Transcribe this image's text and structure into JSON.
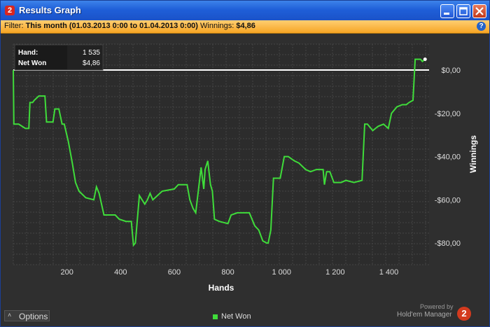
{
  "window": {
    "title": "Results Graph",
    "app_icon_char": "2",
    "buttons": {
      "minimize_icon": "minimize-icon",
      "maximize_icon": "maximize-icon",
      "close_icon": "close-icon"
    }
  },
  "filter_bar": {
    "label": "Filter:",
    "period": "This month (01.03.2013 0:00 to 01.04.2013 0:00)",
    "winnings_label": "Winnings:",
    "winnings_value": "$4,86",
    "help_icon": "help-icon",
    "help_char": "?"
  },
  "tooltip": {
    "hand_label": "Hand:",
    "hand_value": "1 535",
    "net_label": "Net Won",
    "net_value": "$4,86"
  },
  "footer": {
    "options_label": "Options",
    "options_icon": "chevron-up-icon",
    "options_chevron": "˄",
    "legend_label": "Net Won",
    "powered_by": "Powered by",
    "brand": "Hold'em Manager",
    "brand_logo_char": "2"
  },
  "colors": {
    "line": "#3fdc3a",
    "baseline": "#ffffff",
    "plot_bg": "#2c2c2c",
    "title_bar": "#1f5fd8",
    "filter_bar": "#f6a524"
  },
  "chart_data": {
    "type": "line",
    "xlabel": "Hands",
    "ylabel": "Winnings",
    "xlim": [
      0,
      1550
    ],
    "ylim": [
      -90,
      12
    ],
    "x_ticks": [
      200,
      400,
      600,
      800,
      1000,
      1200,
      1400
    ],
    "x_tick_labels": [
      "200",
      "400",
      "600",
      "800",
      "1 000",
      "1 200",
      "1 400"
    ],
    "y_ticks": [
      0,
      -20,
      -40,
      -60,
      -80
    ],
    "y_tick_labels": [
      "$0,00",
      "-$20,00",
      "-$40,00",
      "-$60,00",
      "-$80,00"
    ],
    "grid": true,
    "legend": "bottom-center",
    "series": [
      {
        "name": "Net Won",
        "points": [
          [
            0,
            0
          ],
          [
            2,
            -25
          ],
          [
            20,
            -25
          ],
          [
            45,
            -27
          ],
          [
            58,
            -27
          ],
          [
            62,
            -15
          ],
          [
            72,
            -15
          ],
          [
            78,
            -14
          ],
          [
            95,
            -12
          ],
          [
            102,
            -12
          ],
          [
            118,
            -12
          ],
          [
            124,
            -24
          ],
          [
            148,
            -24
          ],
          [
            155,
            -18
          ],
          [
            170,
            -18
          ],
          [
            182,
            -25
          ],
          [
            190,
            -25
          ],
          [
            205,
            -33
          ],
          [
            220,
            -43
          ],
          [
            232,
            -52
          ],
          [
            245,
            -56
          ],
          [
            270,
            -59
          ],
          [
            300,
            -60
          ],
          [
            310,
            -54
          ],
          [
            320,
            -57
          ],
          [
            338,
            -67
          ],
          [
            360,
            -67
          ],
          [
            380,
            -67
          ],
          [
            395,
            -69
          ],
          [
            420,
            -70
          ],
          [
            440,
            -70
          ],
          [
            448,
            -81
          ],
          [
            455,
            -80
          ],
          [
            470,
            -58
          ],
          [
            490,
            -62
          ],
          [
            500,
            -60
          ],
          [
            510,
            -57
          ],
          [
            520,
            -60
          ],
          [
            555,
            -56
          ],
          [
            600,
            -55
          ],
          [
            615,
            -53
          ],
          [
            648,
            -53
          ],
          [
            658,
            -60
          ],
          [
            670,
            -64
          ],
          [
            680,
            -66
          ],
          [
            700,
            -45
          ],
          [
            710,
            -55
          ],
          [
            715,
            -46
          ],
          [
            725,
            -42
          ],
          [
            735,
            -53
          ],
          [
            742,
            -56
          ],
          [
            750,
            -69
          ],
          [
            768,
            -70
          ],
          [
            800,
            -71
          ],
          [
            812,
            -67
          ],
          [
            835,
            -66
          ],
          [
            880,
            -66
          ],
          [
            900,
            -72
          ],
          [
            915,
            -74
          ],
          [
            930,
            -79
          ],
          [
            945,
            -80
          ],
          [
            950,
            -80
          ],
          [
            960,
            -74
          ],
          [
            970,
            -50
          ],
          [
            995,
            -50
          ],
          [
            1010,
            -40
          ],
          [
            1025,
            -40
          ],
          [
            1048,
            -42
          ],
          [
            1065,
            -43
          ],
          [
            1090,
            -46
          ],
          [
            1108,
            -47
          ],
          [
            1130,
            -46
          ],
          [
            1155,
            -46
          ],
          [
            1160,
            -53
          ],
          [
            1168,
            -47
          ],
          [
            1180,
            -47
          ],
          [
            1195,
            -52
          ],
          [
            1222,
            -52
          ],
          [
            1240,
            -51
          ],
          [
            1270,
            -52
          ],
          [
            1300,
            -51
          ],
          [
            1310,
            -25
          ],
          [
            1320,
            -25
          ],
          [
            1340,
            -28
          ],
          [
            1360,
            -26
          ],
          [
            1380,
            -25
          ],
          [
            1398,
            -27
          ],
          [
            1410,
            -20
          ],
          [
            1430,
            -17
          ],
          [
            1450,
            -16
          ],
          [
            1465,
            -16
          ],
          [
            1475,
            -15
          ],
          [
            1490,
            -14
          ],
          [
            1498,
            5
          ],
          [
            1505,
            5
          ],
          [
            1518,
            5
          ],
          [
            1525,
            4
          ],
          [
            1535,
            5
          ]
        ]
      }
    ]
  }
}
